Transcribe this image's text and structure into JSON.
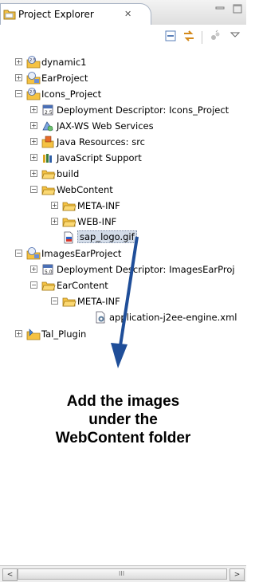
{
  "view": {
    "title": "Project Explorer",
    "close_glyph": "✕",
    "minimize_glyph": "▭",
    "maximize_glyph": "□"
  },
  "toolbar": {
    "buttons": [
      "collapse-all-icon",
      "link-with-editor-icon",
      "view-menu-icon",
      "view-dropdown-icon"
    ]
  },
  "tree": {
    "items": [
      {
        "label": "dynamic1",
        "icon": "web-project-icon",
        "expander": "+"
      },
      {
        "label": "EarProject",
        "icon": "ear-project-icon",
        "expander": "+"
      },
      {
        "label": "Icons_Project",
        "icon": "web-project-icon",
        "expander": "−"
      },
      {
        "label": "Deployment Descriptor: Icons_Project",
        "icon": "deployment-descriptor-icon",
        "expander": "+"
      },
      {
        "label": "JAX-WS Web Services",
        "icon": "web-services-icon",
        "expander": "+"
      },
      {
        "label": "Java Resources: src",
        "icon": "java-resources-icon",
        "expander": "+"
      },
      {
        "label": "JavaScript Support",
        "icon": "javascript-library-icon",
        "expander": "+"
      },
      {
        "label": "build",
        "icon": "folder-icon",
        "expander": "+"
      },
      {
        "label": "WebContent",
        "icon": "folder-icon",
        "expander": "−"
      },
      {
        "label": "META-INF",
        "icon": "folder-icon",
        "expander": "+"
      },
      {
        "label": "WEB-INF",
        "icon": "folder-icon",
        "expander": "+"
      },
      {
        "label": "sap_logo.gif",
        "icon": "gif-file-icon",
        "expander": ""
      },
      {
        "label": "ImagesEarProject",
        "icon": "ear-project-icon",
        "expander": "−"
      },
      {
        "label": "Deployment Descriptor: ImagesEarProj",
        "icon": "deployment-descriptor-icon",
        "expander": "+"
      },
      {
        "label": "EarContent",
        "icon": "folder-icon",
        "expander": "−"
      },
      {
        "label": "META-INF",
        "icon": "folder-icon",
        "expander": "−"
      },
      {
        "label": "application-j2ee-engine.xml",
        "icon": "xml-file-icon",
        "expander": ""
      },
      {
        "label": "Tal_Plugin",
        "icon": "plugin-project-icon",
        "expander": "+"
      }
    ]
  },
  "annotation": {
    "lines": [
      "Add the images",
      "under the",
      "WebContent folder"
    ]
  },
  "scrollbar": {
    "left_glyph": "<",
    "right_glyph": ">",
    "grip_glyph": "III"
  },
  "colors": {
    "selection": "#d3dce8",
    "folder": "#f5c242",
    "arrow": "#1f4e99"
  }
}
